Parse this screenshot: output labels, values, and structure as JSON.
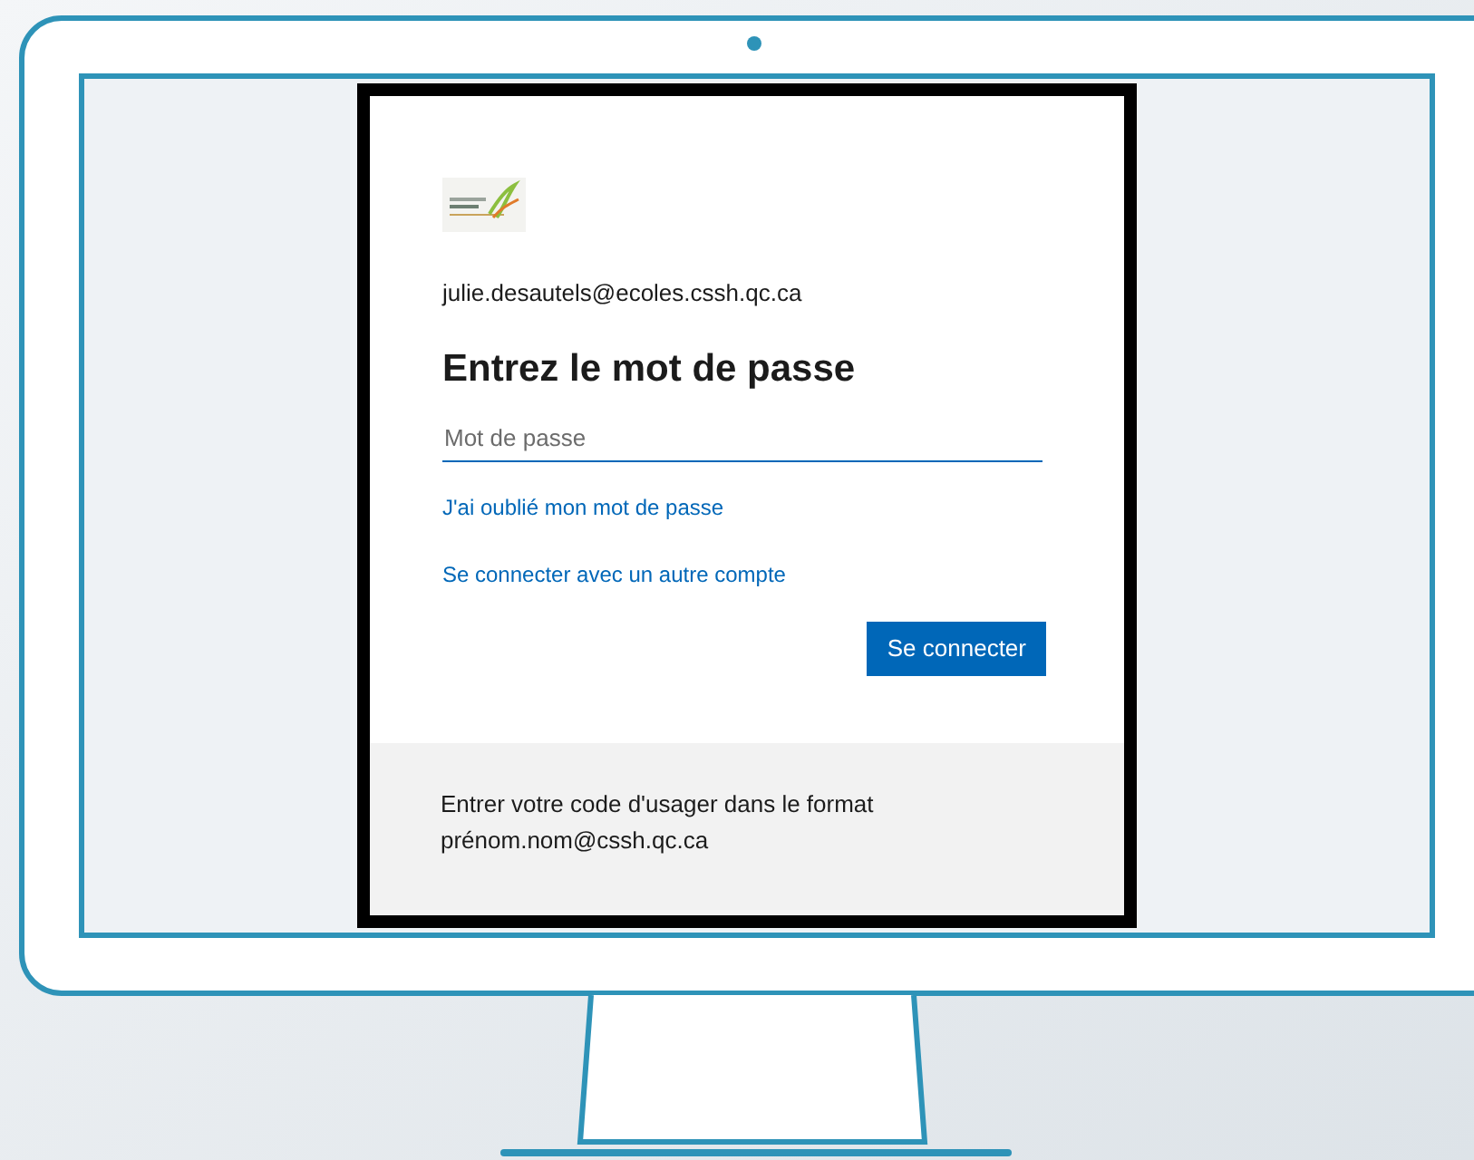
{
  "account": {
    "email": "julie.desautels@ecoles.cssh.qc.ca"
  },
  "heading": "Entrez le mot de passe",
  "password_field": {
    "placeholder": "Mot de passe"
  },
  "links": [
    "J'ai oublié mon mot de passe",
    "Se connecter avec un autre compte"
  ],
  "submit_button": "Se connecter",
  "footer": {
    "text": "Entrer votre code d'usager dans le format prénom.nom@cssh.qc.ca"
  }
}
